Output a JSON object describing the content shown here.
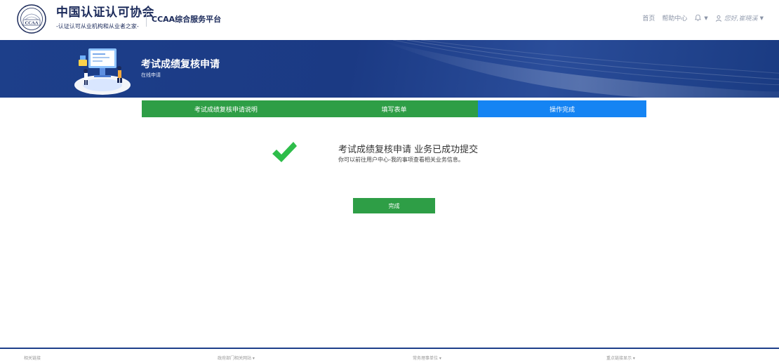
{
  "header": {
    "logo_text": "CCAA",
    "brand_title": "中国认证认可协会",
    "brand_sub": "-认证认可从业机构和从业者之家-",
    "platform": "CCAA综合服务平台",
    "nav": {
      "home": "首页",
      "help": "帮助中心",
      "user": "您好,崔晓溪"
    }
  },
  "banner": {
    "title": "考试成绩复核申请",
    "subtitle": "在线申请"
  },
  "steps": [
    {
      "label": "考试成绩复核申请说明",
      "state": "done"
    },
    {
      "label": "填写表单",
      "state": "done"
    },
    {
      "label": "操作完成",
      "state": "active"
    }
  ],
  "result": {
    "title": "考试成绩复核申请 业务已成功提交",
    "description": "你可以前往用户中心-我的事项查看相关业务信息。",
    "button": "完成"
  },
  "footer": {
    "links": [
      "相关链接",
      "政府部门相关网站",
      "常务理事单位",
      "重点链接显示"
    ]
  },
  "colors": {
    "primary_navy": "#1d3f8a",
    "success_green": "#2e9e46",
    "active_blue": "#1584f3"
  },
  "icons": {
    "logo": "ccaa-seal-icon",
    "bell": "bell-icon",
    "user": "user-icon",
    "check": "checkmark-icon"
  }
}
